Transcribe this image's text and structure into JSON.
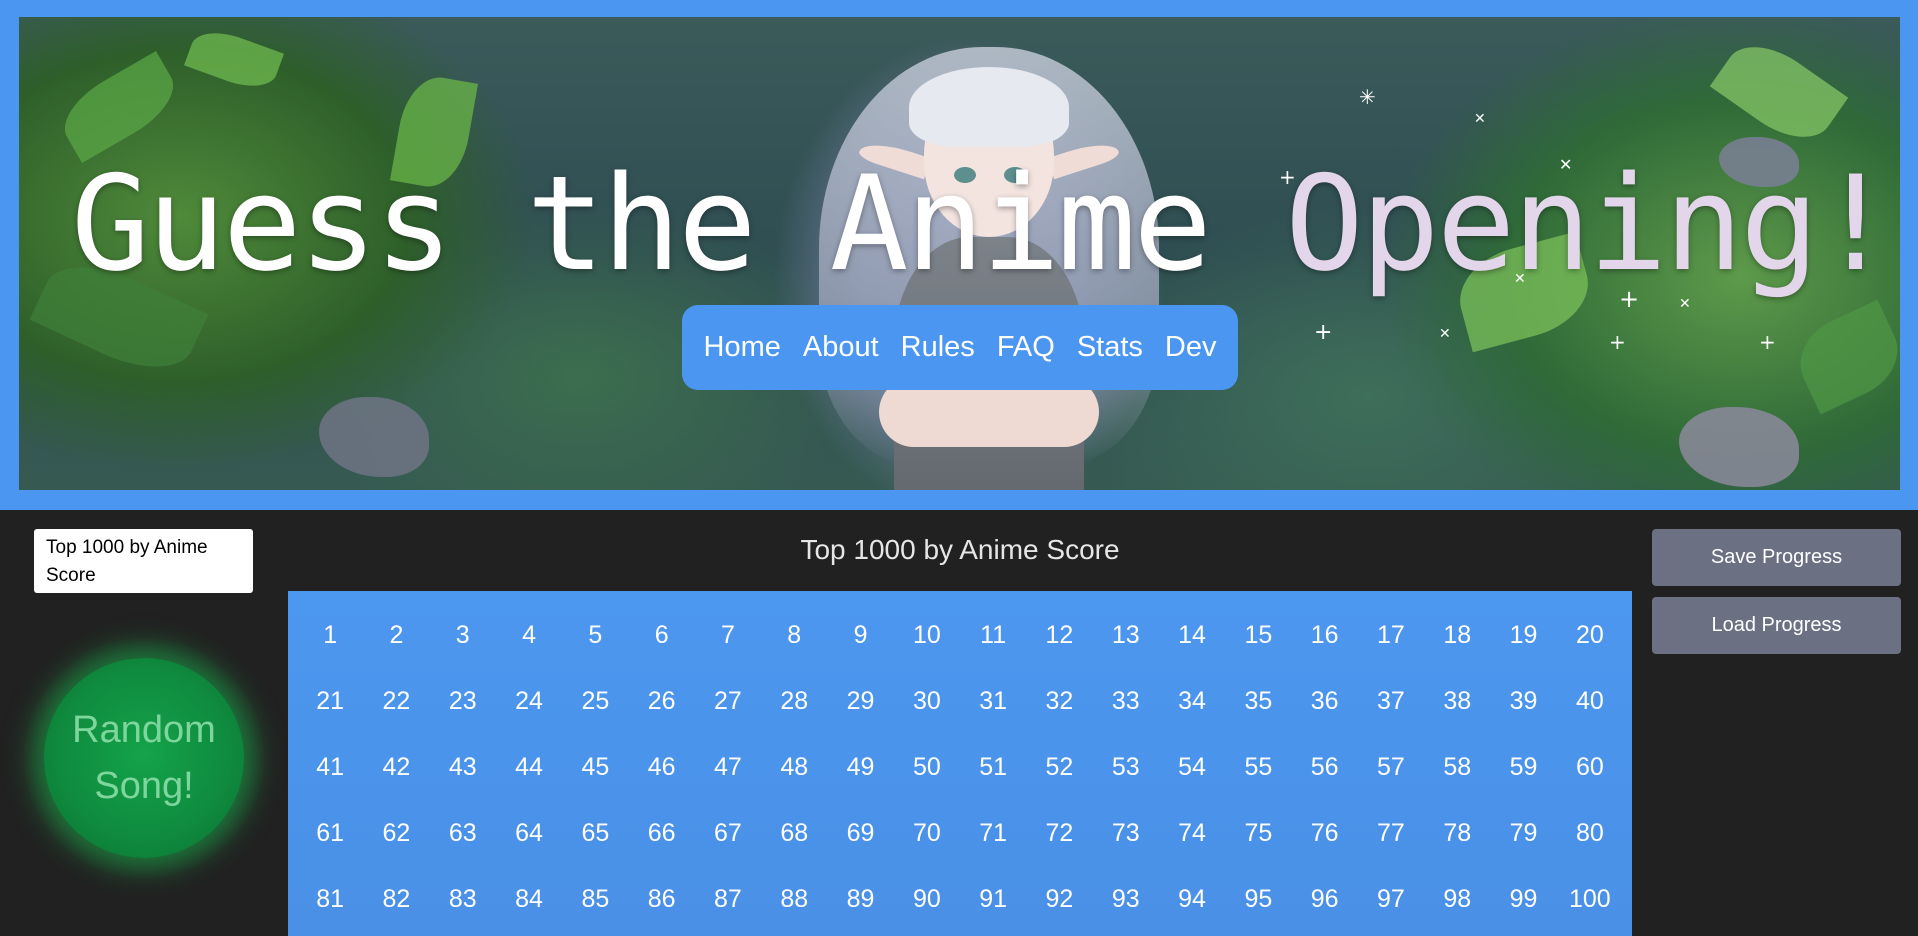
{
  "header": {
    "title_main": "Guess the Anime ",
    "title_accent": "Opening!",
    "nav": [
      "Home",
      "About",
      "Rules",
      "FAQ",
      "Stats",
      "Dev"
    ]
  },
  "sidebar": {
    "dropdown_value": "Top 1000 by Anime Score",
    "random_button": "Random Song!"
  },
  "main": {
    "list_title": "Top 1000 by Anime Score",
    "numbers": [
      1,
      2,
      3,
      4,
      5,
      6,
      7,
      8,
      9,
      10,
      11,
      12,
      13,
      14,
      15,
      16,
      17,
      18,
      19,
      20,
      21,
      22,
      23,
      24,
      25,
      26,
      27,
      28,
      29,
      30,
      31,
      32,
      33,
      34,
      35,
      36,
      37,
      38,
      39,
      40,
      41,
      42,
      43,
      44,
      45,
      46,
      47,
      48,
      49,
      50,
      51,
      52,
      53,
      54,
      55,
      56,
      57,
      58,
      59,
      60,
      61,
      62,
      63,
      64,
      65,
      66,
      67,
      68,
      69,
      70,
      71,
      72,
      73,
      74,
      75,
      76,
      77,
      78,
      79,
      80,
      81,
      82,
      83,
      84,
      85,
      86,
      87,
      88,
      89,
      90,
      91,
      92,
      93,
      94,
      95,
      96,
      97,
      98,
      99,
      100
    ]
  },
  "actions": {
    "save_label": "Save Progress",
    "load_label": "Load Progress"
  },
  "colors": {
    "accent_blue": "#4a96f0",
    "background": "#212121",
    "random_green": "#14a34a",
    "side_button": "#6b7082"
  }
}
